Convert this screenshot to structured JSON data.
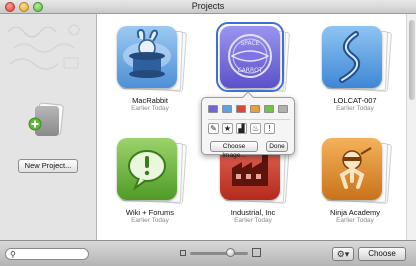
{
  "window": {
    "title": "Projects"
  },
  "sidebar": {
    "new_project_label": "New Project..."
  },
  "projects": [
    {
      "name": "MacRabbit",
      "date": "Earlier Today",
      "icon": "rabbit-hat-icon",
      "color": "#6aa7e6"
    },
    {
      "name": "",
      "date": "",
      "icon": "space-carrot-icon",
      "color": "#6f67d8"
    },
    {
      "name": "LOLCAT-007",
      "date": "Earlier Today",
      "icon": "swirl-icon",
      "color": "#4f9be0"
    },
    {
      "name": "Wiki + Forums",
      "date": "Earlier Today",
      "icon": "speech-bubble-icon",
      "color": "#6cb83a"
    },
    {
      "name": "Industrial, Inc",
      "date": "Earlier Today",
      "icon": "factory-icon",
      "color": "#c93a2c"
    },
    {
      "name": "Ninja Academy",
      "date": "Earlier Today",
      "icon": "ninja-icon",
      "color": "#e08f24"
    }
  ],
  "popover": {
    "swatches": [
      "#6f67d8",
      "#5da2e6",
      "#d84a3a",
      "#e6a03a",
      "#74c04a",
      "#b0b0b0"
    ],
    "icons": [
      {
        "name": "edit-icon",
        "glyph": "✎"
      },
      {
        "name": "star-icon",
        "glyph": "★"
      },
      {
        "name": "factory-icon",
        "glyph": "▟"
      },
      {
        "name": "flame-icon",
        "glyph": "♨"
      },
      {
        "name": "alert-icon",
        "glyph": "!"
      }
    ],
    "choose_image_label": "Choose Image...",
    "done_label": "Done"
  },
  "footer": {
    "search_placeholder": "",
    "zoom_level": 0.7,
    "choose_label": "Choose"
  }
}
